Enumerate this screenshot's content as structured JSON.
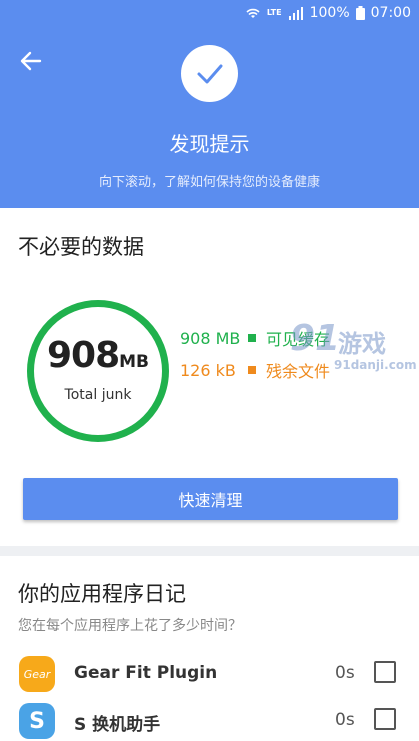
{
  "status_bar": {
    "network": "LTE",
    "battery": "100%",
    "time": "07:00"
  },
  "header": {
    "title": "发现提示",
    "subtitle": "向下滚动，了解如何保持您的设备健康"
  },
  "junk_card": {
    "title": "不必要的数据",
    "amount_number": "908",
    "amount_unit": "MB",
    "amount_label": "Total junk",
    "items": [
      {
        "value": "908 MB",
        "label": "可见缓存",
        "color": "#20b14d"
      },
      {
        "value": "126 kB",
        "label": "残余文件",
        "color": "#ef8a1d"
      }
    ],
    "clean_button": "快速清理"
  },
  "watermark": {
    "big": "91",
    "name": "游戏",
    "small": "91danji.com"
  },
  "diary_card": {
    "title": "你的应用程序日记",
    "subtitle": "您在每个应用程序上花了多少时间？",
    "apps": [
      {
        "name": "Gear Fit Plugin",
        "time": "0s",
        "icon_text": "Gear",
        "icon_color": "#f7a91a"
      },
      {
        "name": "S 换机助手",
        "time": "0s",
        "icon_text": "S",
        "icon_color": "#4aa3e6"
      }
    ]
  },
  "colors": {
    "accent": "#5b8def",
    "green": "#20b14d",
    "orange": "#ef8a1d"
  }
}
